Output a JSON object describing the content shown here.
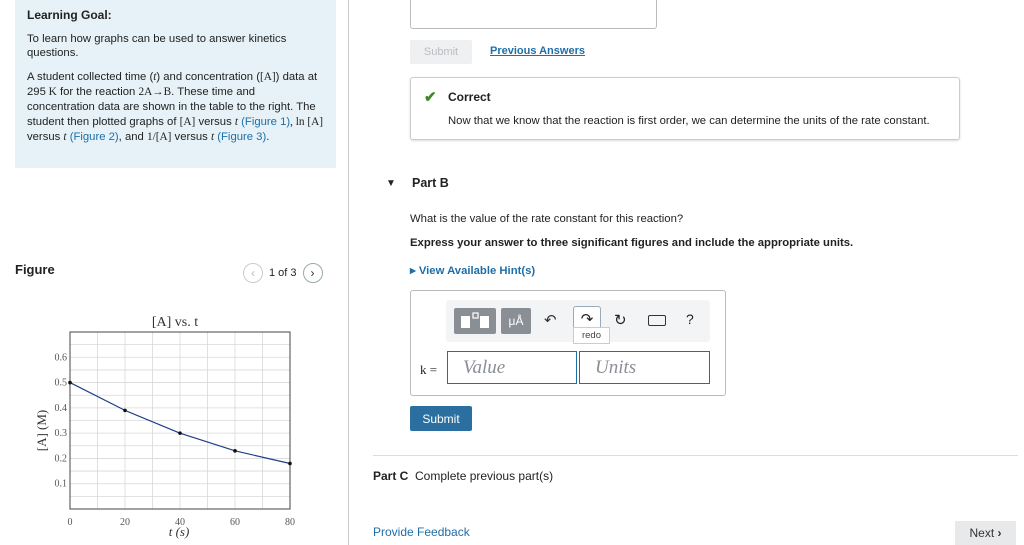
{
  "goal": {
    "title": "Learning Goal:",
    "intro": "To learn how graphs can be used to answer kinetics questions.",
    "p2_a": "A student collected time (",
    "p2_t": "t",
    "p2_b": ") and concentration (",
    "p2_A": "[A]",
    "p2_c": ") data at 295",
    "p2_K": " K",
    "p2_d": " for the reaction ",
    "p2_rxn": "2A→B",
    "p2_e": ". These time and concentration data are shown in the table to the right. The student then plotted graphs of ",
    "p2_f": " versus ",
    "link1": "(Figure 1)",
    "p2_ln": ", ln [A]",
    "link2": "(Figure 2)",
    "p2_g": ", and ",
    "p2_inv": "1/[A]",
    "link3": "(Figure 3)",
    "p2_end": "."
  },
  "figure": {
    "label": "Figure",
    "pager": "1 of 3",
    "prev_icon": "chevron-left-icon",
    "next_icon": "chevron-right-icon"
  },
  "chart_data": {
    "type": "line",
    "title": "[A] vs. t",
    "xlabel": "t (s)",
    "ylabel": "[A] (M)",
    "x": [
      0,
      20,
      40,
      60,
      80
    ],
    "xticks": [
      "0",
      "20",
      "40",
      "60",
      "80"
    ],
    "yticks": [
      "0.1",
      "0.2",
      "0.3",
      "0.4",
      "0.5",
      "0.6"
    ],
    "y": [
      0.5,
      0.39,
      0.3,
      0.23,
      0.18
    ],
    "xlim": [
      0,
      80
    ],
    "ylim": [
      0,
      0.7
    ],
    "grid": true
  },
  "previous": {
    "submit_label": "Submit",
    "previous_answers": "Previous Answers"
  },
  "feedback_box": {
    "status": "Correct",
    "message": "Now that we know that the reaction is first order, we can determine the units of the rate constant."
  },
  "partB": {
    "title": "Part B",
    "question": "What is the value of the rate constant for this reaction?",
    "instruction": "Express your answer to three significant figures and include the appropriate units.",
    "hint_link": "View Available Hint(s)",
    "toolbar": {
      "units_btn": "μÅ",
      "redo_tooltip": "redo",
      "help": "?"
    },
    "var_label": "k =",
    "value_placeholder": "Value",
    "units_placeholder": "Units",
    "submit_label": "Submit"
  },
  "partC": {
    "title": "Part C",
    "status": "Complete previous part(s)"
  },
  "footer": {
    "provide_feedback": "Provide Feedback",
    "next_label": "Next",
    "next_icon": "chevron-right-icon"
  }
}
